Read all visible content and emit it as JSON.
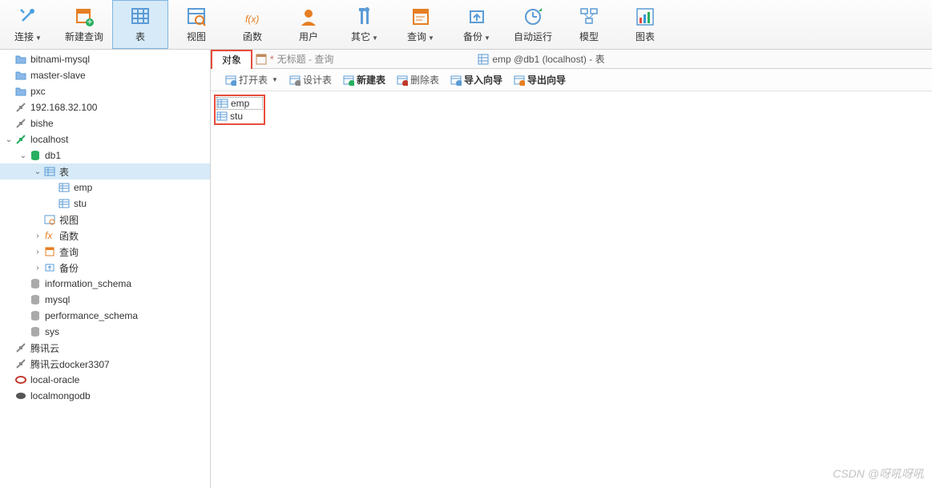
{
  "toolbar": [
    {
      "label": "连接",
      "icon": "plug",
      "drop": true
    },
    {
      "label": "新建查询",
      "icon": "newquery"
    },
    {
      "label": "表",
      "icon": "table",
      "active": true
    },
    {
      "label": "视图",
      "icon": "view"
    },
    {
      "label": "函数",
      "icon": "fx"
    },
    {
      "label": "用户",
      "icon": "user"
    },
    {
      "label": "其它",
      "icon": "tools",
      "drop": true
    },
    {
      "label": "查询",
      "icon": "query",
      "drop": true
    },
    {
      "label": "备份",
      "icon": "backup",
      "drop": true
    },
    {
      "label": "自动运行",
      "icon": "auto"
    },
    {
      "label": "模型",
      "icon": "model"
    },
    {
      "label": "图表",
      "icon": "chart"
    }
  ],
  "tree": [
    {
      "d": 0,
      "exp": "",
      "icon": "folder",
      "label": "bitnami-mysql"
    },
    {
      "d": 0,
      "exp": "",
      "icon": "folder",
      "label": "master-slave"
    },
    {
      "d": 0,
      "exp": "",
      "icon": "folder",
      "label": "pxc"
    },
    {
      "d": 0,
      "exp": "",
      "icon": "conn-off",
      "label": "192.168.32.100"
    },
    {
      "d": 0,
      "exp": "",
      "icon": "conn-off",
      "label": "bishe"
    },
    {
      "d": 0,
      "exp": "v",
      "icon": "conn-on",
      "label": "localhost"
    },
    {
      "d": 1,
      "exp": "v",
      "icon": "db",
      "label": "db1"
    },
    {
      "d": 2,
      "exp": "v",
      "icon": "table-s",
      "label": "表",
      "selected": true
    },
    {
      "d": 3,
      "exp": "",
      "icon": "table-s",
      "label": "emp"
    },
    {
      "d": 3,
      "exp": "",
      "icon": "table-s",
      "label": "stu"
    },
    {
      "d": 2,
      "exp": "",
      "icon": "view-s",
      "label": "视图"
    },
    {
      "d": 2,
      "exp": ">",
      "icon": "fx-s",
      "label": "函数"
    },
    {
      "d": 2,
      "exp": ">",
      "icon": "query-s",
      "label": "查询"
    },
    {
      "d": 2,
      "exp": ">",
      "icon": "backup-s",
      "label": "备份"
    },
    {
      "d": 1,
      "exp": "",
      "icon": "db-off",
      "label": "information_schema"
    },
    {
      "d": 1,
      "exp": "",
      "icon": "db-off",
      "label": "mysql"
    },
    {
      "d": 1,
      "exp": "",
      "icon": "db-off",
      "label": "performance_schema"
    },
    {
      "d": 1,
      "exp": "",
      "icon": "db-off",
      "label": "sys"
    },
    {
      "d": 0,
      "exp": "",
      "icon": "conn-off",
      "label": "腾讯云"
    },
    {
      "d": 0,
      "exp": "",
      "icon": "conn-off",
      "label": "腾讯云docker3307"
    },
    {
      "d": 0,
      "exp": "",
      "icon": "oracle",
      "label": "local-oracle"
    },
    {
      "d": 0,
      "exp": "",
      "icon": "mongo",
      "label": "localmongodb"
    }
  ],
  "tabs": {
    "active": "对象",
    "untitled_marker": "*",
    "untitled": "无标题 - 查询",
    "detail": "emp @db1 (localhost) - 表"
  },
  "subtool": [
    {
      "label": "打开表",
      "icon": "open",
      "drop": true
    },
    {
      "label": "设计表",
      "icon": "design"
    },
    {
      "label": "新建表",
      "icon": "new",
      "bold": true
    },
    {
      "label": "删除表",
      "icon": "delete"
    },
    {
      "label": "导入向导",
      "icon": "import",
      "bold": true
    },
    {
      "label": "导出向导",
      "icon": "export",
      "bold": true
    }
  ],
  "list": [
    {
      "label": "emp",
      "sel": true
    },
    {
      "label": "stu"
    }
  ],
  "watermark": "CSDN @呀吼呀吼"
}
